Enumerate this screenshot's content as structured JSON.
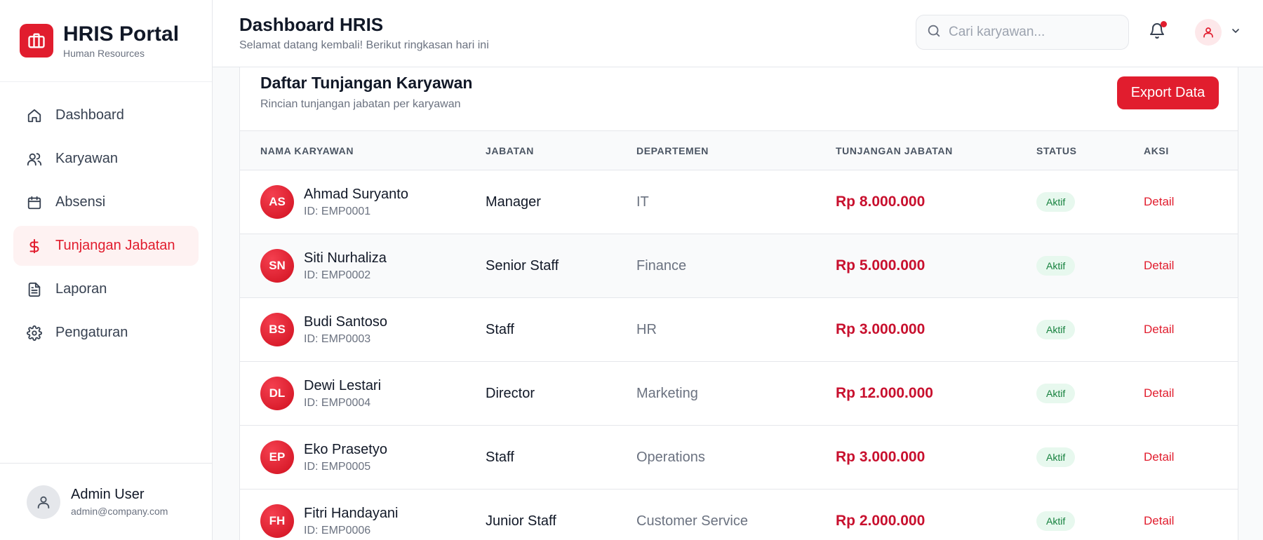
{
  "brand": {
    "title": "HRIS Portal",
    "subtitle": "Human Resources"
  },
  "sidebar": {
    "items": [
      {
        "label": "Dashboard",
        "icon": "home-icon"
      },
      {
        "label": "Karyawan",
        "icon": "users-icon"
      },
      {
        "label": "Absensi",
        "icon": "calendar-icon"
      },
      {
        "label": "Tunjangan Jabatan",
        "icon": "dollar-icon",
        "active": true
      },
      {
        "label": "Laporan",
        "icon": "document-icon"
      },
      {
        "label": "Pengaturan",
        "icon": "gear-icon"
      }
    ]
  },
  "user": {
    "name": "Admin User",
    "email": "admin@company.com"
  },
  "header": {
    "title": "Dashboard HRIS",
    "subtitle": "Selamat datang kembali! Berikut ringkasan hari ini",
    "search_placeholder": "Cari karyawan..."
  },
  "card": {
    "title": "Daftar Tunjangan Karyawan",
    "subtitle": "Rincian tunjangan jabatan per karyawan",
    "export_label": "Export Data"
  },
  "table": {
    "columns": [
      "NAMA KARYAWAN",
      "JABATAN",
      "DEPARTEMEN",
      "TUNJANGAN JABATAN",
      "STATUS",
      "AKSI"
    ],
    "rows": [
      {
        "initials": "AS",
        "name": "Ahmad Suryanto",
        "id": "ID: EMP0001",
        "jabatan": "Manager",
        "departemen": "IT",
        "tunjangan": "Rp 8.000.000",
        "status": "Aktif",
        "aksi": "Detail"
      },
      {
        "initials": "SN",
        "name": "Siti Nurhaliza",
        "id": "ID: EMP0002",
        "jabatan": "Senior Staff",
        "departemen": "Finance",
        "tunjangan": "Rp 5.000.000",
        "status": "Aktif",
        "aksi": "Detail"
      },
      {
        "initials": "BS",
        "name": "Budi Santoso",
        "id": "ID: EMP0003",
        "jabatan": "Staff",
        "departemen": "HR",
        "tunjangan": "Rp 3.000.000",
        "status": "Aktif",
        "aksi": "Detail"
      },
      {
        "initials": "DL",
        "name": "Dewi Lestari",
        "id": "ID: EMP0004",
        "jabatan": "Director",
        "departemen": "Marketing",
        "tunjangan": "Rp 12.000.000",
        "status": "Aktif",
        "aksi": "Detail"
      },
      {
        "initials": "EP",
        "name": "Eko Prasetyo",
        "id": "ID: EMP0005",
        "jabatan": "Staff",
        "departemen": "Operations",
        "tunjangan": "Rp 3.000.000",
        "status": "Aktif",
        "aksi": "Detail"
      },
      {
        "initials": "FH",
        "name": "Fitri Handayani",
        "id": "ID: EMP0006",
        "jabatan": "Junior Staff",
        "departemen": "Customer Service",
        "tunjangan": "Rp 2.000.000",
        "status": "Aktif",
        "aksi": "Detail"
      }
    ]
  },
  "colors": {
    "accent": "#e11d2e",
    "accent_soft": "#fef2f2",
    "success_bg": "#e7f8ee",
    "success_text": "#15803d"
  }
}
